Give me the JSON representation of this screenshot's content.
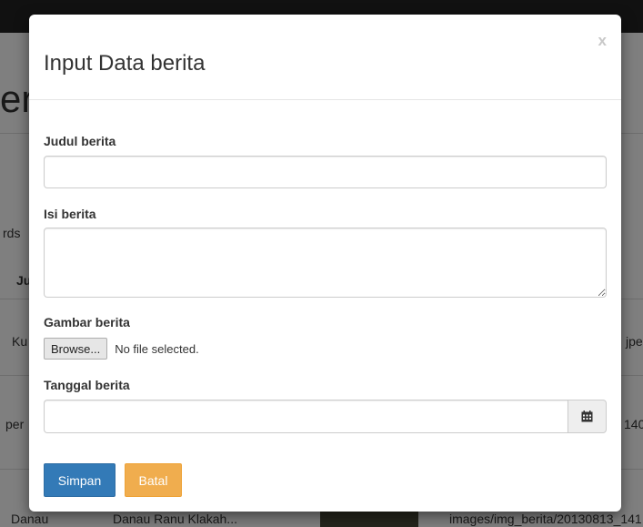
{
  "background": {
    "heading_left": "er",
    "heading_right": "",
    "records_label": "rds",
    "col_header": "Ju",
    "row1_left": "Ku",
    "row1_right": "jpe",
    "row2_left": "per",
    "row2_right": "140",
    "row3_left": "Danau",
    "row3_mid": "Danau Ranu Klakah...",
    "row3_right": "images/img_berita/20130813_141"
  },
  "modal": {
    "title": "Input Data berita",
    "close_label": "x",
    "fields": {
      "judul": {
        "label": "Judul berita",
        "value": ""
      },
      "isi": {
        "label": "Isi berita",
        "value": ""
      },
      "gambar": {
        "label": "Gambar berita",
        "browse_label": "Browse...",
        "status": "No file selected."
      },
      "tanggal": {
        "label": "Tanggal berita",
        "value": ""
      }
    },
    "buttons": {
      "save": "Simpan",
      "cancel": "Batal"
    }
  },
  "colors": {
    "primary": "#337ab7",
    "warning": "#f0ad4e",
    "navbar": "#222222"
  },
  "icons": {
    "calendar": "calendar-icon"
  }
}
